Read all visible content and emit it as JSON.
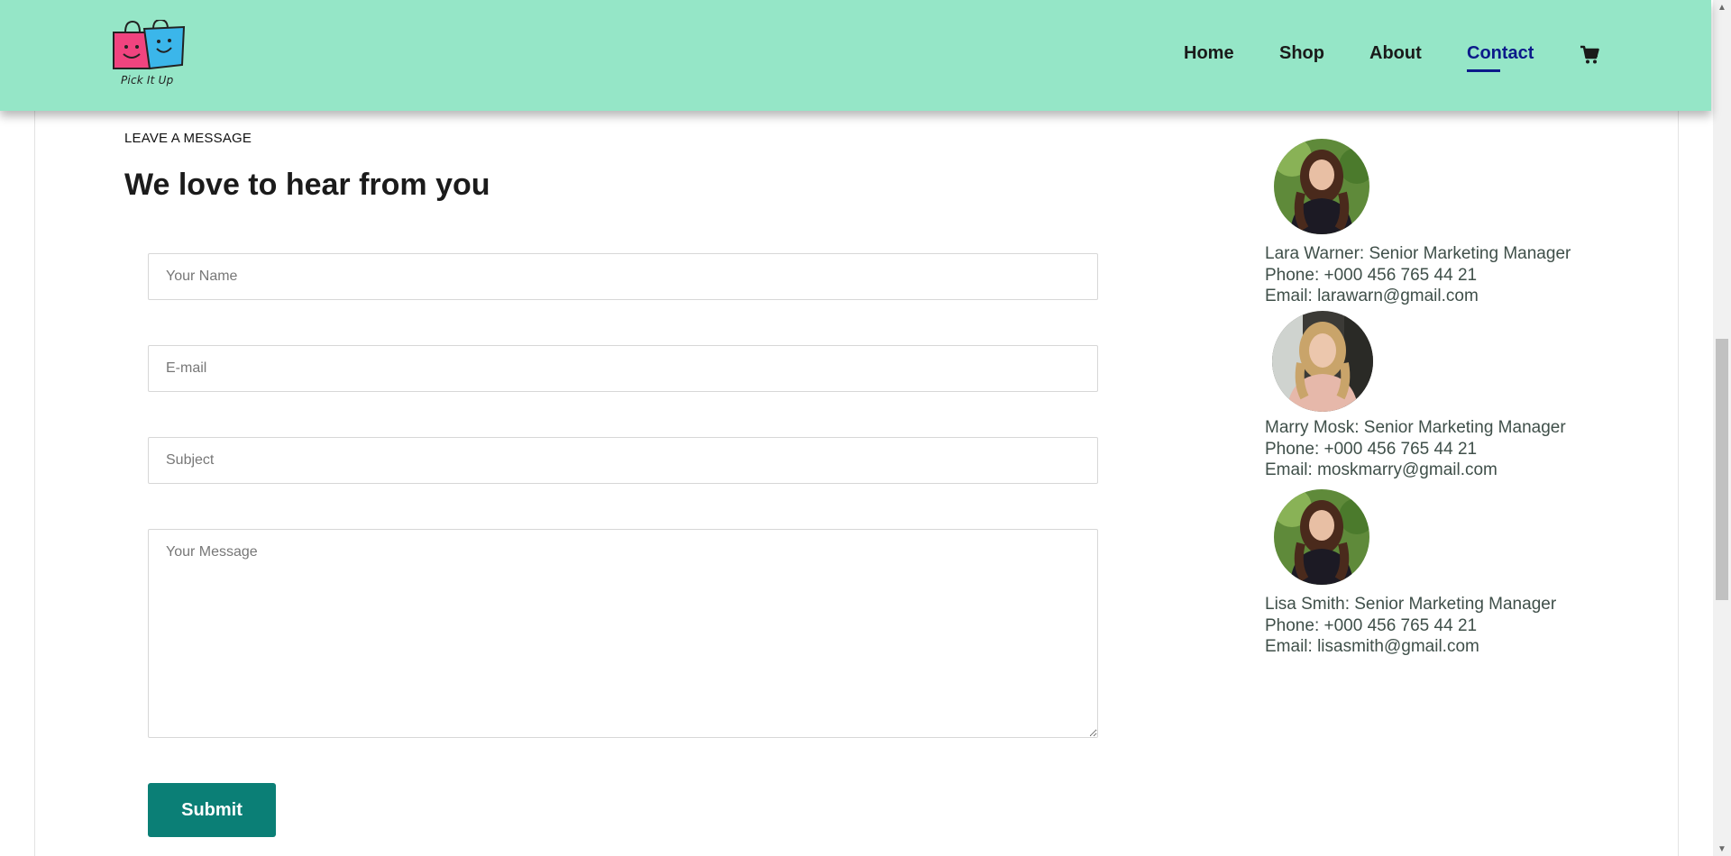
{
  "brand": {
    "name": "Pick It Up"
  },
  "nav": {
    "items": [
      {
        "label": "Home",
        "active": false
      },
      {
        "label": "Shop",
        "active": false
      },
      {
        "label": "About",
        "active": false
      },
      {
        "label": "Contact",
        "active": true
      }
    ],
    "cart_icon": "shopping-cart-icon"
  },
  "form": {
    "eyebrow": "LEAVE A MESSAGE",
    "heading": "We love to hear from you",
    "name_placeholder": "Your Name",
    "email_placeholder": "E-mail",
    "subject_placeholder": "Subject",
    "message_placeholder": "Your Message",
    "submit_label": "Submit"
  },
  "contacts": [
    {
      "title_line": "Lara Warner: Senior Marketing Manager",
      "phone_line": "Phone: +000 456 765 44 21",
      "email_line": "Email: larawarn@gmail.com"
    },
    {
      "title_line": "Marry Mosk: Senior Marketing Manager",
      "phone_line": "Phone: +000 456 765 44 21",
      "email_line": "Email: moskmarry@gmail.com"
    },
    {
      "title_line": "Lisa Smith: Senior Marketing Manager",
      "phone_line": "Phone: +000 456 765 44 21",
      "email_line": "Email: lisasmith@gmail.com"
    }
  ],
  "colors": {
    "header_bg": "#95e6c7",
    "active_nav": "#0c1a8a",
    "submit_bg": "#0b7f76",
    "contact_text": "#3f4f49"
  }
}
